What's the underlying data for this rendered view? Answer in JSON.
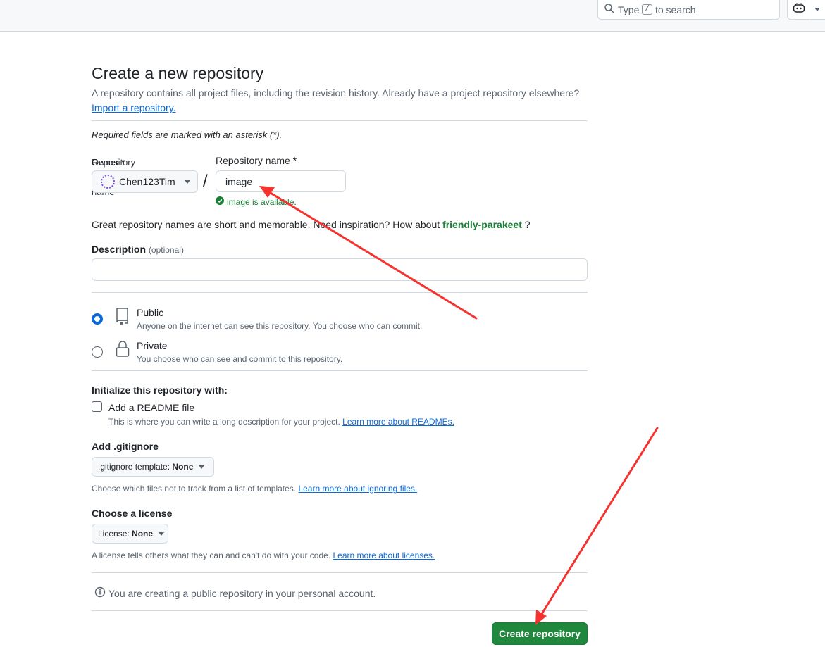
{
  "header": {
    "search_prefix": "Type",
    "search_key": "/",
    "search_suffix": "to search"
  },
  "page": {
    "title": "Create a new repository",
    "subtitle": "A repository contains all project files, including the revision history. Already have a project repository elsewhere?",
    "import_link": "Import a repository.",
    "required_note": "Required fields are marked with an asterisk (*)."
  },
  "owner": {
    "label_overlap_a": "Owner *",
    "label_overlap_b": "Repository owner and name",
    "value": "Chen123Tim"
  },
  "repo": {
    "separator": "/",
    "label": "Repository name *",
    "value": "image",
    "availability": "image is available."
  },
  "suggestion": {
    "prefix": "Great repository names are short and memorable. Need inspiration? How about",
    "name": "friendly-parakeet",
    "suffix": "?"
  },
  "description": {
    "label": "Description",
    "optional": "(optional)",
    "value": ""
  },
  "visibility": {
    "selected": "Public",
    "options": [
      {
        "title": "Public",
        "desc": "Anyone on the internet can see this repository. You choose who can commit."
      },
      {
        "title": "Private",
        "desc": "You choose who can see and commit to this repository."
      }
    ]
  },
  "initialize": {
    "label": "Initialize this repository with:",
    "readme_label": "Add a README file",
    "readme_checked": false,
    "readme_desc": "This is where you can write a long description for your project.",
    "readme_link": "Learn more about READMEs."
  },
  "gitignore": {
    "label": "Add .gitignore",
    "select_prefix": ".gitignore template:",
    "select_value": "None",
    "hint": "Choose which files not to track from a list of templates.",
    "hint_link": "Learn more about ignoring files."
  },
  "license": {
    "label": "Choose a license",
    "select_prefix": "License:",
    "select_value": "None",
    "hint": "A license tells others what they can and can't do with your code.",
    "hint_link": "Learn more about licenses."
  },
  "info_note": "You are creating a public repository in your personal account.",
  "create_button": "Create repository",
  "colors": {
    "primary_button": "#1f883d",
    "link": "#0969da",
    "success": "#1a7f37",
    "annotation_arrow": "#f5322d"
  },
  "icons": [
    "search-icon",
    "copilot-icon",
    "dropdown-caret-icon",
    "check-circle-icon",
    "repo-icon",
    "lock-icon",
    "info-icon"
  ]
}
